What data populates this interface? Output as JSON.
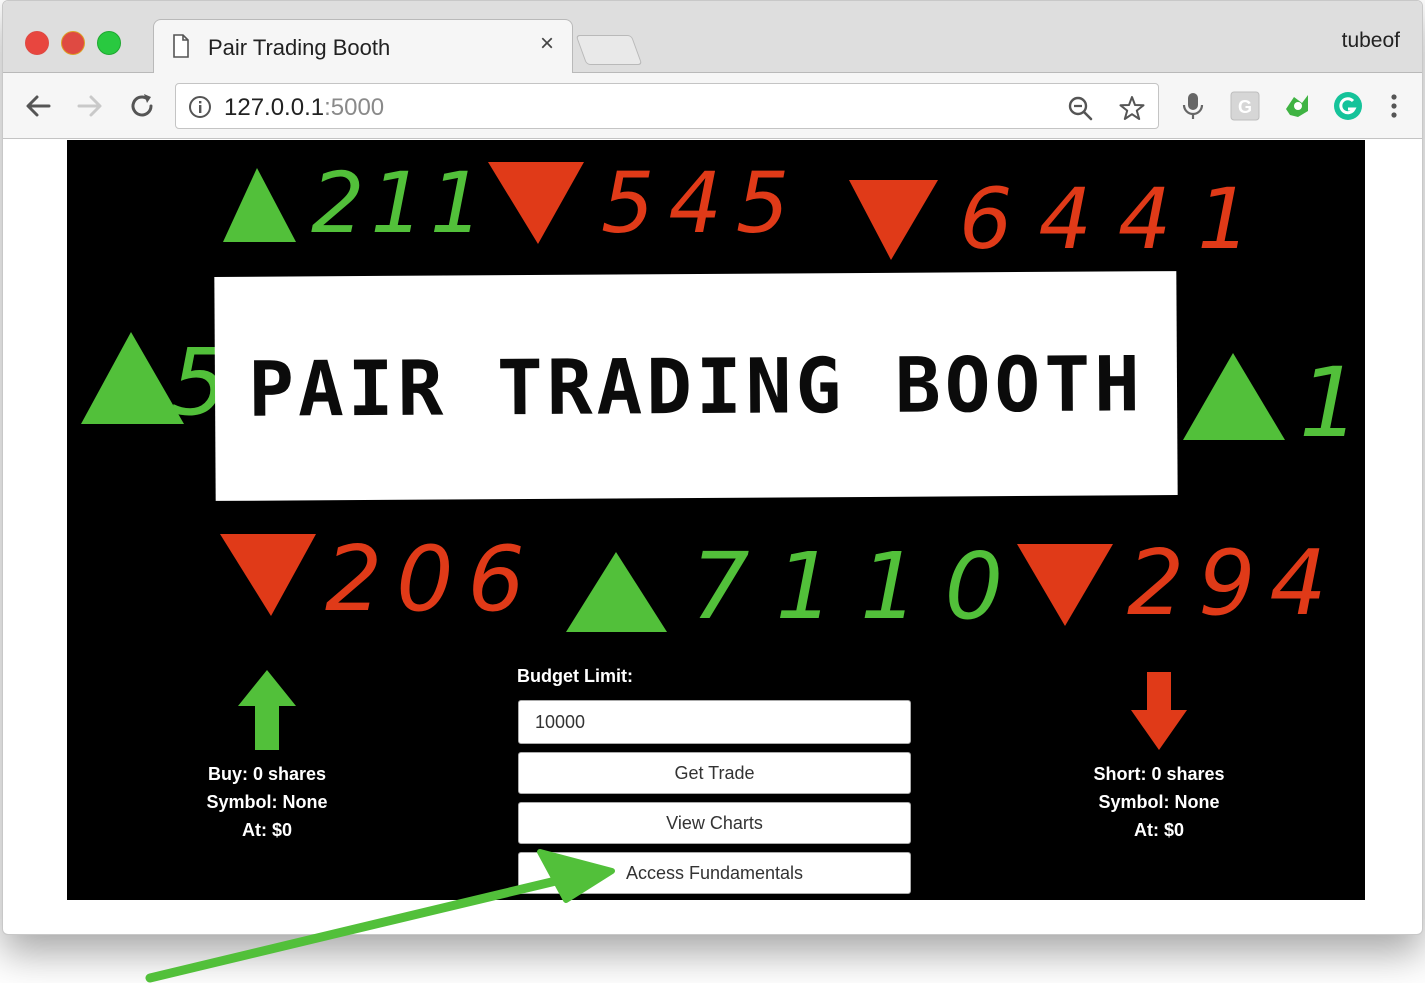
{
  "browser": {
    "tab_title": "Pair Trading Booth",
    "tab_close": "×",
    "profile_name": "tubeof",
    "url_host": "127.0.0.1",
    "url_port": ":5000",
    "icons": [
      "back-icon",
      "forward-icon",
      "reload-icon",
      "info-icon",
      "zoom-icon",
      "star-icon",
      "mic-icon",
      "grammarly-g-icon",
      "extension-icon",
      "grammarly-icon",
      "menu-icon"
    ]
  },
  "ticker": {
    "top": [
      {
        "dir": "up",
        "digits": "211"
      },
      {
        "dir": "down",
        "digits": "545"
      },
      {
        "dir": "down",
        "digits": "6441"
      }
    ],
    "middle_left": {
      "dir": "up",
      "digits": "5"
    },
    "middle_right": {
      "dir": "up",
      "digits": "1"
    },
    "bottom": [
      {
        "dir": "down",
        "digits": "206"
      },
      {
        "dir": "up",
        "digits": "7110"
      },
      {
        "dir": "down",
        "digits": "294"
      }
    ],
    "colors": {
      "up": "#52c03a",
      "down": "#e03a18"
    }
  },
  "banner": {
    "title": "PAIR TRADING BOOTH"
  },
  "form": {
    "label": "Budget Limit:",
    "budget_value": "10000",
    "buttons": {
      "get_trade": "Get Trade",
      "view_charts": "View Charts",
      "access_fundamentals": "Access Fundamentals"
    }
  },
  "buy": {
    "line1_prefix": "Buy: ",
    "line1_value": "0 shares",
    "line2_prefix": "Symbol: ",
    "line2_value": "None",
    "line3_prefix": "At: ",
    "line3_value": "$0"
  },
  "short": {
    "line1_prefix": "Short: ",
    "line1_value": "0 shares",
    "line2_prefix": "Symbol: ",
    "line2_value": "None",
    "line3_prefix": "At: ",
    "line3_value": "$0"
  }
}
